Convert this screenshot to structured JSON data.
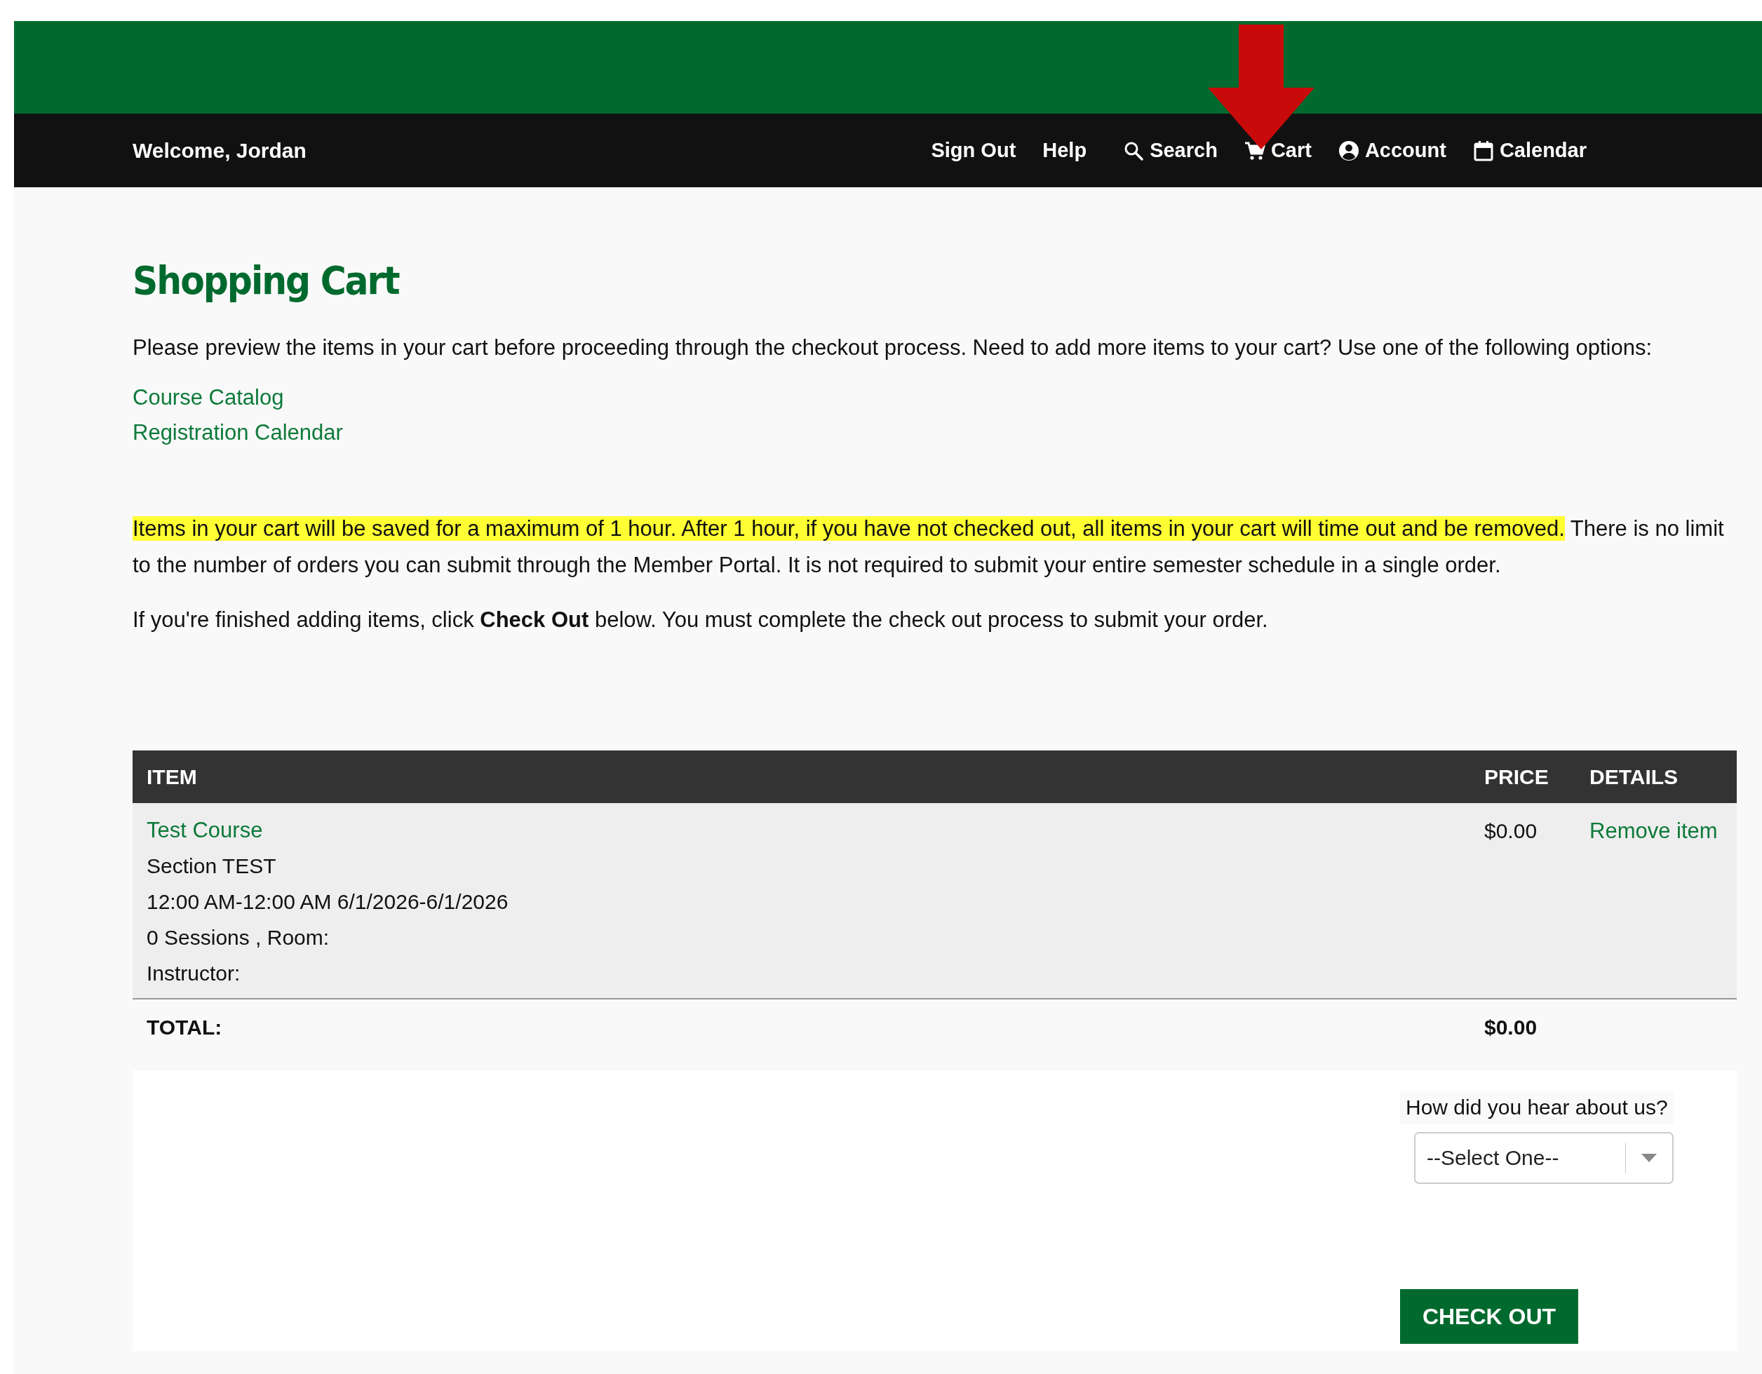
{
  "header": {
    "welcome": "Welcome, Jordan",
    "nav": [
      {
        "label": "Sign Out"
      },
      {
        "label": "Help"
      },
      {
        "label": "Search"
      },
      {
        "label": "Cart"
      },
      {
        "label": "Account"
      },
      {
        "label": "Calendar"
      }
    ]
  },
  "page": {
    "title": "Shopping Cart",
    "intro": "Please preview the items in your cart before proceeding through the checkout process. Need to add more items to your cart? Use one of the following options:",
    "links": [
      "Course Catalog",
      "Registration Calendar"
    ],
    "notice": {
      "highlighted": "Items in your cart will be saved for a maximum of 1 hour. After 1 hour, if you have not checked out, all items in your cart will time out and be removed.",
      "rest": " There is no limit to the number of orders you can submit through the Member Portal. It is not required to submit your entire semester schedule in a single order."
    },
    "instruction": "If you're finished adding items, click **Check Out** below. You must complete the check out process to submit your order."
  },
  "cart": {
    "columns": [
      "ITEM",
      "PRICE",
      "DETAILS"
    ],
    "rows": [
      {
        "course": "Test Course",
        "lines": [
          "Section TEST",
          "12:00 AM-12:00 AM 6/1/2026-6/1/2026",
          "0 Sessions , Room:",
          "Instructor:"
        ],
        "price": "$0.00",
        "action": "Remove item"
      }
    ],
    "total_label": "TOTAL:",
    "total": "$0.00"
  },
  "checkout": {
    "question": "How did you hear about us?",
    "select": {
      "value": "--Select One--"
    },
    "button": "CHECK OUT"
  }
}
